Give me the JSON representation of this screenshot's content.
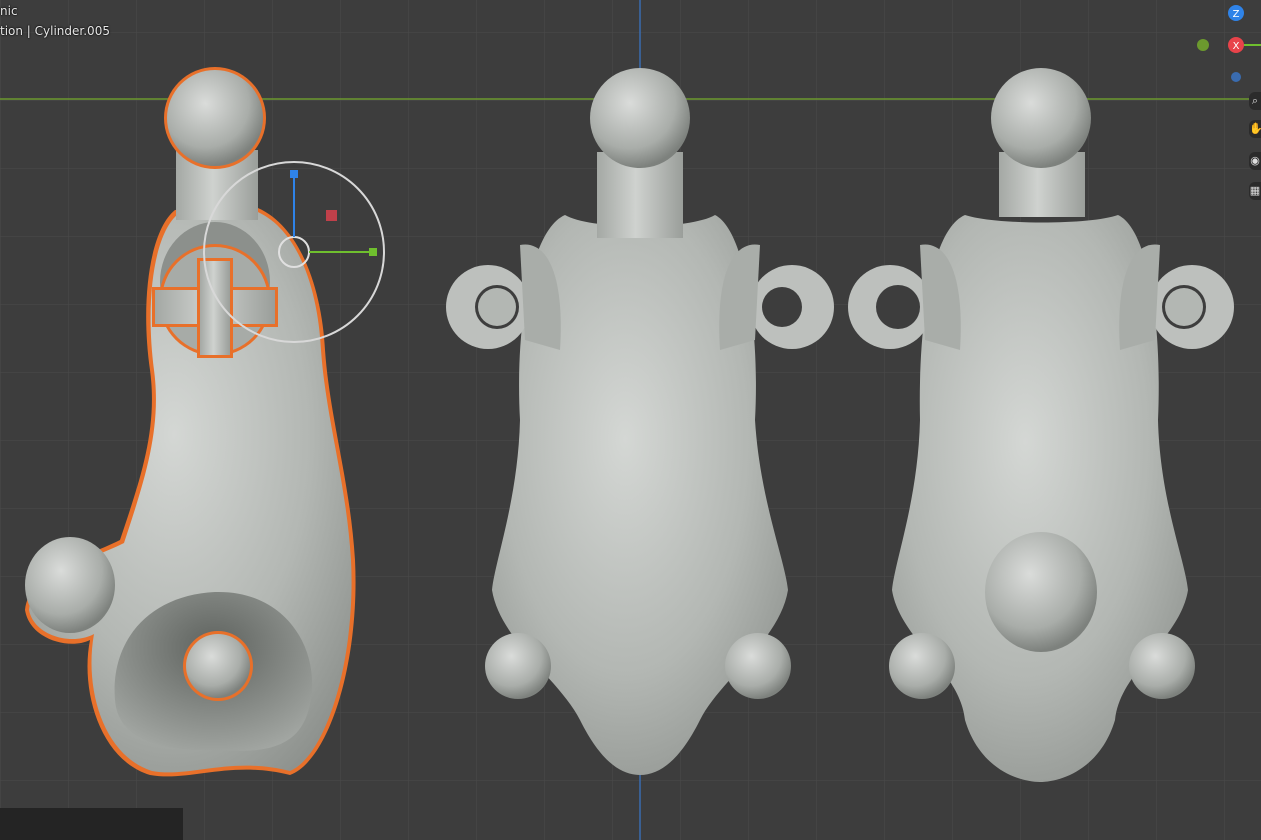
{
  "viewport": {
    "overlay": {
      "mode_line": "nic",
      "collection_line": "tion | Cylinder.005"
    },
    "gizmo": {
      "axes": [
        {
          "label": "Z",
          "color": "#2f83e8"
        },
        {
          "label": "X",
          "color": "#e8434a"
        },
        {
          "label": "",
          "color": "#6c9a2e"
        },
        {
          "label": "",
          "color": "#3a6cb0"
        }
      ]
    },
    "side_tools": [
      {
        "icon": "zoom-icon"
      },
      {
        "icon": "hand-pan-icon"
      },
      {
        "icon": "camera-icon"
      },
      {
        "icon": "grid-view-icon"
      }
    ],
    "colors": {
      "background": "#3d3d3d",
      "grid": "#4a4a4a",
      "x_axis_line": "#6c9a2e",
      "y_axis_line": "#3a6cb0",
      "selection_outline": "#e8702a",
      "mesh": "#b8bcb8"
    }
  }
}
